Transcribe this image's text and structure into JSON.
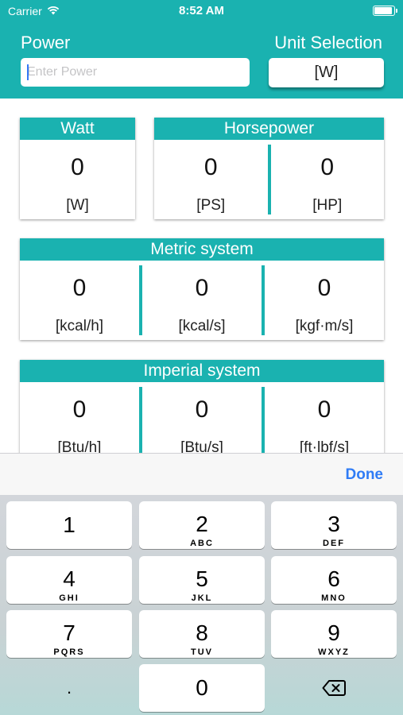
{
  "status_bar": {
    "carrier": "Carrier",
    "time": "8:52 AM"
  },
  "header": {
    "power_label": "Power",
    "unit_label": "Unit Selection",
    "input_placeholder": "Enter Power",
    "unit_value": "[W]"
  },
  "cards": {
    "watt": {
      "title": "Watt",
      "cells": [
        {
          "value": "0",
          "unit": "[W]"
        }
      ]
    },
    "horsepower": {
      "title": "Horsepower",
      "cells": [
        {
          "value": "0",
          "unit": "[PS]"
        },
        {
          "value": "0",
          "unit": "[HP]"
        }
      ]
    },
    "metric": {
      "title": "Metric system",
      "cells": [
        {
          "value": "0",
          "unit": "[kcal/h]"
        },
        {
          "value": "0",
          "unit": "[kcal/s]"
        },
        {
          "value": "0",
          "unit": "[kgf·m/s]"
        }
      ]
    },
    "imperial": {
      "title": "Imperial system",
      "cells": [
        {
          "value": "0",
          "unit": "[Btu/h]"
        },
        {
          "value": "0",
          "unit": "[Btu/s]"
        },
        {
          "value": "0",
          "unit": "[ft·lbf/s]"
        }
      ]
    }
  },
  "keyboard": {
    "done_label": "Done",
    "keys": [
      {
        "digit": "1",
        "letters": ""
      },
      {
        "digit": "2",
        "letters": "ABC"
      },
      {
        "digit": "3",
        "letters": "DEF"
      },
      {
        "digit": "4",
        "letters": "GHI"
      },
      {
        "digit": "5",
        "letters": "JKL"
      },
      {
        "digit": "6",
        "letters": "MNO"
      },
      {
        "digit": "7",
        "letters": "PQRS"
      },
      {
        "digit": "8",
        "letters": "TUV"
      },
      {
        "digit": "9",
        "letters": "WXYZ"
      }
    ],
    "decimal_label": ".",
    "zero_label": "0",
    "delete_icon": "backspace-icon"
  },
  "colors": {
    "accent": "#1ab2b0",
    "done": "#2f7cf6"
  }
}
